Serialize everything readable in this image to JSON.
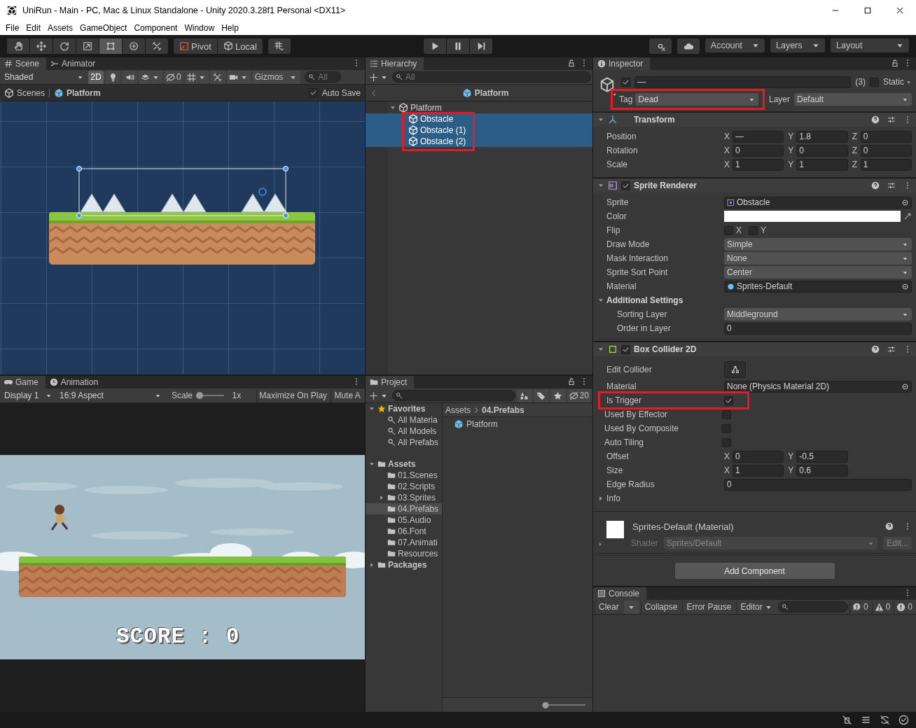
{
  "window": {
    "title": "UniRun - Main - PC, Mac & Linux Standalone - Unity 2020.3.28f1 Personal <DX11>"
  },
  "menu": [
    "File",
    "Edit",
    "Assets",
    "GameObject",
    "Component",
    "Window",
    "Help"
  ],
  "toolbar": {
    "tools": [
      {
        "kind": "hand",
        "selected": false
      },
      {
        "kind": "move",
        "selected": false
      },
      {
        "kind": "rotate",
        "selected": false
      },
      {
        "kind": "scale",
        "selected": false
      },
      {
        "kind": "rect",
        "selected": true
      },
      {
        "kind": "transform",
        "selected": false
      },
      {
        "kind": "tools",
        "selected": false
      }
    ],
    "pivot": "Pivot",
    "local": "Local",
    "account": "Account",
    "layers": "Layers",
    "layout": "Layout"
  },
  "scene_panel": {
    "tabs": [
      {
        "kind": "scene",
        "label": "Scene",
        "selected": true
      },
      {
        "kind": "animator",
        "label": "Animator",
        "selected": false
      }
    ],
    "shading": "Shaded",
    "mode_2d": {
      "label": "2D",
      "on": true
    },
    "hidden_count": "0",
    "gizmos": "Gizmos",
    "search_placeholder": "All",
    "breadcrumb": {
      "root": "Scenes",
      "prefab": "Platform"
    },
    "auto_save": {
      "label": "Auto Save",
      "checked": true
    }
  },
  "game_panel": {
    "tabs": [
      {
        "kind": "game",
        "label": "Game",
        "selected": true
      },
      {
        "kind": "animation",
        "label": "Animation",
        "selected": false
      }
    ],
    "display": "Display 1",
    "aspect": "16:9 Aspect",
    "scale": {
      "label": "Scale",
      "level": 0,
      "reading": "1x"
    },
    "maximize": "Maximize On Play",
    "mute": "Mute A",
    "score_text": "SCORE : 0"
  },
  "hierarchy": {
    "tab": "Hierarchy",
    "search_placeholder": "All",
    "breadcrumb": "Platform",
    "tree": [
      {
        "label": "Platform",
        "expanded": true,
        "selected": false,
        "children_annotated": true,
        "children": [
          {
            "label": "Obstacle",
            "selected": true
          },
          {
            "label": "Obstacle (1)",
            "selected": true
          },
          {
            "label": "Obstacle (2)",
            "selected": true
          }
        ]
      }
    ]
  },
  "project": {
    "tab": "Project",
    "hidden_count": "20",
    "tree": [
      {
        "kind": "favorites",
        "label": "Favorites",
        "expanded": true,
        "selected": false,
        "children": [
          {
            "kind": "search",
            "label": "All Materia",
            "selected": false
          },
          {
            "kind": "search",
            "label": "All Models",
            "selected": false
          },
          {
            "kind": "search",
            "label": "All Prefabs",
            "selected": false
          }
        ]
      },
      {
        "kind": "folder",
        "label": "Assets",
        "expanded": true,
        "selected": false,
        "children": [
          {
            "kind": "folder",
            "label": "01.Scenes",
            "selected": false
          },
          {
            "kind": "folder",
            "label": "02.Scripts",
            "selected": false
          },
          {
            "kind": "folder",
            "label": "03.Sprites",
            "expanded": false,
            "selected": false
          },
          {
            "kind": "folder",
            "label": "04.Prefabs",
            "selected": true
          },
          {
            "kind": "folder",
            "label": "05.Audio",
            "selected": false
          },
          {
            "kind": "folder",
            "label": "06.Font",
            "selected": false
          },
          {
            "kind": "folder",
            "label": "07.Animati",
            "selected": false
          },
          {
            "kind": "folder",
            "label": "Resources",
            "selected": false
          }
        ]
      },
      {
        "kind": "folder",
        "label": "Packages",
        "expanded": false,
        "selected": false
      }
    ],
    "path": [
      "Assets",
      "04.Prefabs"
    ],
    "items": [
      {
        "kind": "prefab",
        "label": "Platform"
      }
    ],
    "zoom": {
      "level": 0.05
    }
  },
  "inspector": {
    "tab": "Inspector",
    "object": {
      "active": true,
      "name": "—",
      "count": "(3)",
      "static": {
        "label": "Static",
        "checked": false
      }
    },
    "tag": {
      "label": "Tag",
      "value": "Dead",
      "annotated": true
    },
    "layer": {
      "label": "Layer",
      "value": "Default"
    },
    "components": [
      {
        "kind": "transform",
        "title": "Transform",
        "expanded": true,
        "rows": [
          {
            "kind": "vector",
            "label": "Position",
            "values": [
              {
                "axis": "X",
                "value": "—"
              },
              {
                "axis": "Y",
                "value": "1.8"
              },
              {
                "axis": "Z",
                "value": "0"
              }
            ]
          },
          {
            "kind": "vector",
            "label": "Rotation",
            "values": [
              {
                "axis": "X",
                "value": "0"
              },
              {
                "axis": "Y",
                "value": "0"
              },
              {
                "axis": "Z",
                "value": "0"
              }
            ]
          },
          {
            "kind": "vector",
            "label": "Scale",
            "values": [
              {
                "axis": "X",
                "value": "1"
              },
              {
                "axis": "Y",
                "value": "1"
              },
              {
                "axis": "Z",
                "value": "1"
              }
            ]
          }
        ]
      },
      {
        "kind": "sprite_renderer",
        "title": "Sprite Renderer",
        "enabled": true,
        "expanded": true,
        "rows": [
          {
            "kind": "sprite_field",
            "label": "Sprite",
            "value": "Obstacle"
          },
          {
            "kind": "color",
            "label": "Color",
            "color": "#ffffff"
          },
          {
            "kind": "toggles",
            "label": "Flip",
            "items": [
              {
                "label": "X",
                "checked": false
              },
              {
                "label": "Y",
                "checked": false
              }
            ]
          },
          {
            "kind": "dropdown",
            "label": "Draw Mode",
            "value": "Simple"
          },
          {
            "kind": "dropdown",
            "label": "Mask Interaction",
            "value": "None"
          },
          {
            "kind": "dropdown",
            "label": "Sprite Sort Point",
            "value": "Center"
          },
          {
            "kind": "material_field",
            "label": "Material",
            "value": "Sprites-Default"
          },
          {
            "kind": "foldout",
            "label": "Additional Settings",
            "expanded": true,
            "children": [
              {
                "kind": "dropdown",
                "label": "Sorting Layer",
                "value": "Middleground"
              },
              {
                "kind": "number",
                "label": "Order in Layer",
                "value": "0"
              }
            ]
          }
        ]
      },
      {
        "kind": "box_collider",
        "title": "Box Collider 2D",
        "enabled": true,
        "expanded": true,
        "rows": [
          {
            "kind": "button",
            "label": "Edit Collider"
          },
          {
            "kind": "object_field",
            "label": "Material",
            "value": "None (Physics Material 2D)"
          },
          {
            "kind": "checkbox",
            "label": "Is Trigger",
            "checked": true,
            "annotated": true
          },
          {
            "kind": "checkbox",
            "label": "Used By Effector",
            "checked": false,
            "annotated": false
          },
          {
            "kind": "checkbox",
            "label": "Used By Composite",
            "checked": false,
            "annotated": false
          },
          {
            "kind": "checkbox",
            "label": "Auto Tiling",
            "checked": false,
            "annotated": false
          },
          {
            "kind": "vector",
            "label": "Offset",
            "values": [
              {
                "axis": "X",
                "value": "0"
              },
              {
                "axis": "Y",
                "value": "-0.5"
              }
            ]
          },
          {
            "kind": "vector",
            "label": "Size",
            "values": [
              {
                "axis": "X",
                "value": "1"
              },
              {
                "axis": "Y",
                "value": "0.6"
              }
            ]
          },
          {
            "kind": "number",
            "label": "Edge Radius",
            "value": "0"
          },
          {
            "kind": "foldout",
            "label": "Info",
            "expanded": false
          }
        ]
      }
    ],
    "material": {
      "title": "Sprites-Default (Material)",
      "expanded": false,
      "shader_label": "Shader",
      "shader": "Sprites/Default",
      "edit": "Edit..."
    },
    "add_component": "Add Component"
  },
  "console": {
    "tab": "Console",
    "clear": "Clear",
    "collapse": "Collapse",
    "error_pause": "Error Pause",
    "editor": "Editor",
    "counts": [
      {
        "kind": "info",
        "count": "0"
      },
      {
        "kind": "warning",
        "count": "0"
      },
      {
        "kind": "error",
        "count": "0"
      }
    ]
  }
}
